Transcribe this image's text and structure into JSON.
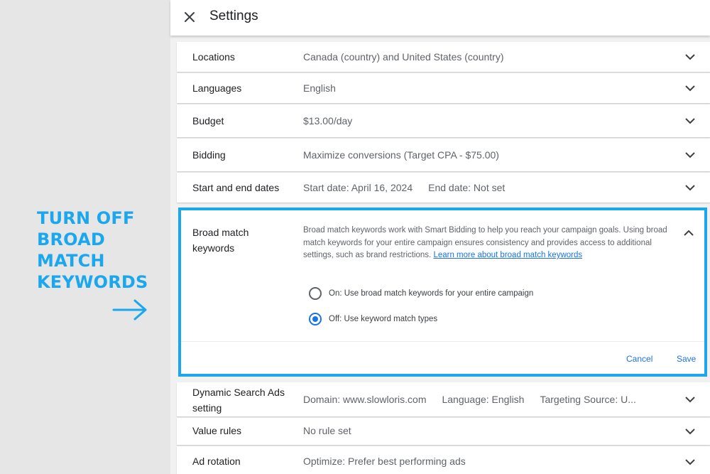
{
  "callout": {
    "lines": [
      "TURN OFF",
      "BROAD",
      "MATCH",
      "KEYWORDS"
    ],
    "arrow_icon": "arrow-right-icon",
    "color": "#1aa7ee"
  },
  "header": {
    "title": "Settings",
    "close_icon": "close-icon"
  },
  "rows": [
    {
      "label": "Locations",
      "value": "Canada (country) and United States (country)"
    },
    {
      "label": "Languages",
      "value": "English"
    },
    {
      "label": "Budget",
      "value": "$13.00/day"
    },
    {
      "label": "Bidding",
      "value": "Maximize conversions (Target CPA - $75.00)"
    },
    {
      "label": "Start and end dates",
      "values": [
        "Start date: April 16, 2024",
        "End date: Not set"
      ]
    }
  ],
  "broad_match": {
    "label_line1": "Broad match",
    "label_line2": "keywords",
    "description": "Broad match keywords work with Smart Bidding to help you reach your campaign goals. Using broad match keywords for your entire campaign ensures consistency and provides access to additional settings, such as brand restrictions.",
    "link_text": "Learn more about broad match keywords",
    "options": [
      {
        "label": "On: Use broad match keywords for your entire campaign",
        "selected": false
      },
      {
        "label": "Off: Use keyword match types",
        "selected": true
      }
    ],
    "cancel_label": "Cancel",
    "save_label": "Save",
    "highlight_color": "#1aa7ee"
  },
  "rows_after": [
    {
      "label_line1": "Dynamic Search Ads",
      "label_line2": "setting",
      "values": [
        "Domain: www.slowloris.com",
        "Language: English",
        "Targeting Source: U..."
      ]
    },
    {
      "label": "Value rules",
      "value": "No rule set"
    },
    {
      "label": "Ad rotation",
      "value": "Optimize: Prefer best performing ads"
    }
  ],
  "colors": {
    "link_blue": "#1a73e8",
    "page_background": "#e6e6e6"
  }
}
